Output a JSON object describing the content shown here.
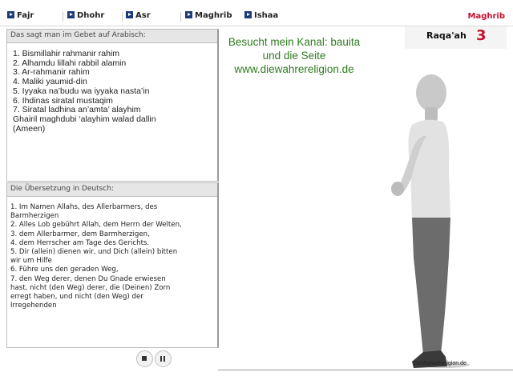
{
  "nav": {
    "items": [
      {
        "label": "Fajr"
      },
      {
        "label": "Dhohr"
      },
      {
        "label": "Asr"
      },
      {
        "label": "Maghrib"
      },
      {
        "label": "Ishaa"
      }
    ],
    "current": "Maghrib"
  },
  "arabic_panel": {
    "title": "Das sagt man im Gebet auf Arabisch:",
    "lines": [
      "1. Bismillahir rahmanir rahim",
      "2. Alhamdu lillahi rabbil alamin",
      "3. Ar-rahmanir rahim",
      "4. Maliki yaumid-din",
      "5. Iyyaka na’budu wa iyyaka nasta’in",
      "6. Ihdinas siratal mustaqim",
      "7. Siratal ladhina an’amta’ alayhim",
      "Ghairil maghdubi ‘alayhim walad dallin",
      "(Ameen)"
    ]
  },
  "translation_panel": {
    "title": "Die Übersetzung in Deutsch:",
    "lines": [
      "1. Im Namen Allahs, des Allerbarmers, des",
      "Barmherzigen",
      "2. Alles Lob gebührt Allah, dem Herrn der Welten,",
      "3. dem Allerbarmer, dem Barmherzigen,",
      "4. dem Herrscher am Tage des Gerichts.",
      "5. Dir (allein) dienen wir, und Dich (allein) bitten",
      "wir um Hilfe",
      "6. Führe uns den geraden Weg,",
      "7. den Weg derer, denen Du Gnade erwiesen",
      "hast, nicht (den Weg) derer, die (Deinen) Zorn",
      "erregt haben, und nicht (den Weg) der",
      "Irregehenden"
    ]
  },
  "channel": {
    "line1": "Besucht mein Kanal: bauita",
    "line2": "und die Seite",
    "line3": "www.diewahrereligion.de"
  },
  "raqaah": {
    "label": "Raqa'ah",
    "count": "3"
  },
  "watermark": "DieWahreReligion.de",
  "colors": {
    "accent_red": "#c8102e",
    "nav_icon_blue": "#1c3a78",
    "channel_green": "#2f7a1f"
  }
}
